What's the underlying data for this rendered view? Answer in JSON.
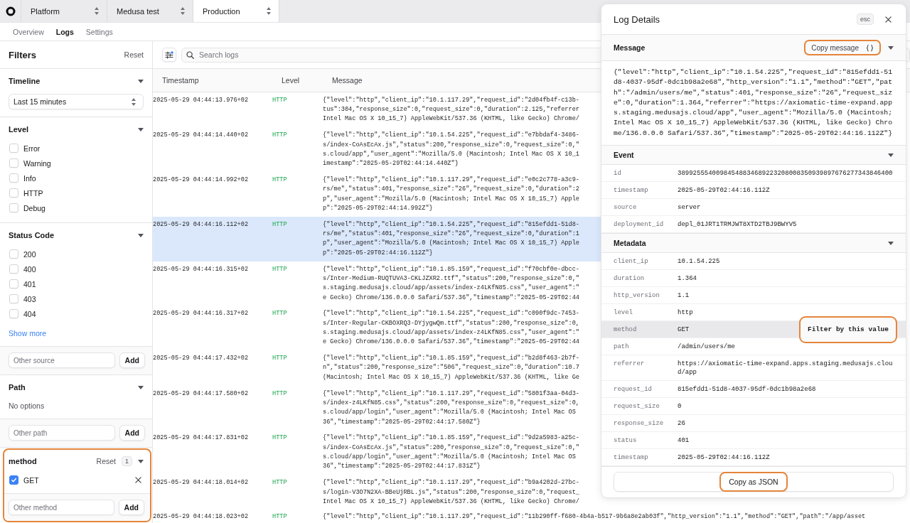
{
  "topbar": {
    "breadcrumbs": [
      {
        "label": "Platform",
        "selected": false
      },
      {
        "label": "Medusa test",
        "selected": false
      },
      {
        "label": "Production",
        "selected": true
      }
    ]
  },
  "tabs": [
    {
      "label": "Overview",
      "selected": false
    },
    {
      "label": "Logs",
      "selected": true
    },
    {
      "label": "Settings",
      "selected": false
    }
  ],
  "filters": {
    "title": "Filters",
    "reset": "Reset",
    "sections": [
      {
        "kind": "select",
        "title": "Timeline",
        "highlighted": false,
        "value": "Last 15 minutes"
      },
      {
        "kind": "checklist",
        "title": "Level",
        "highlighted": false,
        "options": [
          {
            "label": "Error",
            "checked": false
          },
          {
            "label": "Warning",
            "checked": false
          },
          {
            "label": "Info",
            "checked": false
          },
          {
            "label": "HTTP",
            "checked": false
          },
          {
            "label": "Debug",
            "checked": false
          }
        ]
      },
      {
        "kind": "checklist",
        "title": "Status Code",
        "highlighted": false,
        "options": [
          {
            "label": "200",
            "checked": false
          },
          {
            "label": "400",
            "checked": false
          },
          {
            "label": "401",
            "checked": false
          },
          {
            "label": "403",
            "checked": false
          },
          {
            "label": "404",
            "checked": false
          }
        ],
        "more": "Show more",
        "add": {
          "placeholder": "Other source",
          "button": "Add"
        }
      },
      {
        "kind": "empty",
        "title": "Path",
        "highlighted": false,
        "empty_text": "No options",
        "add": {
          "placeholder": "Other path",
          "button": "Add"
        }
      },
      {
        "kind": "checklist",
        "title": "method",
        "highlighted": true,
        "reset": "Reset",
        "count": "1",
        "options": [
          {
            "label": "GET",
            "checked": true
          }
        ],
        "add": {
          "placeholder": "Other method",
          "button": "Add"
        }
      }
    ]
  },
  "toolbar": {
    "search": {
      "placeholder": "Search logs"
    }
  },
  "table": {
    "columns": [
      "Timestamp",
      "Level",
      "Message"
    ],
    "rows": [
      {
        "timestamp": "2025-05-29 04:44:13.976+02",
        "level": "HTTP",
        "selected": false,
        "message": [
          "{\"level\":\"http\",\"client_ip\":\"10.1.117.29\",\"request_id\":\"2d04fb4f-c13b-",
          "tus\":304,\"response_size\":0,\"request_size\":0,\"duration\":2.125,\"referrer",
          "Intel Mac OS X 10_15_7) AppleWebKit/537.36 (KHTML, like Gecko) Chrome/"
        ]
      },
      {
        "timestamp": "2025-05-29 04:44:14.440+02",
        "level": "HTTP",
        "selected": false,
        "message": [
          "{\"level\":\"http\",\"client_ip\":\"10.1.54.225\",\"request_id\":\"e7bbdaf4-3486-",
          "s/index-CoAsEcAx.js\",\"status\":200,\"response_size\":0,\"request_size\":0,\"",
          "s.cloud/app\",\"user_agent\":\"Mozilla/5.0 (Macintosh; Intel Mac OS X 10_1",
          "imestamp\":\"2025-05-29T02:44:14.440Z\"}"
        ]
      },
      {
        "timestamp": "2025-05-29 04:44:14.992+02",
        "level": "HTTP",
        "selected": false,
        "message": [
          "{\"level\":\"http\",\"client_ip\":\"10.1.117.29\",\"request_id\":\"e0c2c778-a3c9-",
          "rs/me\",\"status\":401,\"response_size\":\"26\",\"request_size\":0,\"duration\":2",
          "p\",\"user_agent\":\"Mozilla/5.0 (Macintosh; Intel Mac OS X 10_15_7) Apple",
          "p\":\"2025-05-29T02:44:14.992Z\"}"
        ]
      },
      {
        "timestamp": "2025-05-29 04:44:16.112+02",
        "level": "HTTP",
        "selected": true,
        "message": [
          "{\"level\":\"http\",\"client_ip\":\"10.1.54.225\",\"request_id\":\"815efdd1-51d8-",
          "rs/me\",\"status\":401,\"response_size\":\"26\",\"request_size\":0,\"duration\":1",
          "p\",\"user_agent\":\"Mozilla/5.0 (Macintosh; Intel Mac OS X 10_15_7) Apple",
          "p\":\"2025-05-29T02:44:16.112Z\"}"
        ]
      },
      {
        "timestamp": "2025-05-29 04:44:16.315+02",
        "level": "HTTP",
        "selected": false,
        "message": [
          "{\"level\":\"http\",\"client_ip\":\"10.1.85.159\",\"request_id\":\"f70cbf0e-dbcc-",
          "s/Inter-Medium-RUQTUVA3-CKLJZXR2.ttf\",\"status\":200,\"response_size\":0,\"",
          "s.staging.medusajs.cloud/app/assets/index-z4LKfN85.css\",\"user_agent\":\"",
          "e Gecko) Chrome/136.0.0.0 Safari/537.36\",\"timestamp\":\"2025-05-29T02:44"
        ]
      },
      {
        "timestamp": "2025-05-29 04:44:16.317+02",
        "level": "HTTP",
        "selected": false,
        "message": [
          "{\"level\":\"http\",\"client_ip\":\"10.1.54.225\",\"request_id\":\"c090f9dc-7453-",
          "s/Inter-Regular-CKBOXRQ3-DYjygwQm.ttf\",\"status\":200,\"response_size\":0,",
          "s.staging.medusajs.cloud/app/assets/index-z4LKfN85.css\",\"user_agent\":\"",
          "e Gecko) Chrome/136.0.0.0 Safari/537.36\",\"timestamp\":\"2025-05-29T02:44"
        ]
      },
      {
        "timestamp": "2025-05-29 04:44:17.432+02",
        "level": "HTTP",
        "selected": false,
        "message": [
          "{\"level\":\"http\",\"client_ip\":\"10.1.85.159\",\"request_id\":\"b2d8f463-2b7f-",
          "n\",\"status\":200,\"response_size\":\"506\",\"request_size\":0,\"duration\":10.7",
          "(Macintosh; Intel Mac OS X 10_15_7) AppleWebKit/537.36 (KHTML, like Ge"
        ]
      },
      {
        "timestamp": "2025-05-29 04:44:17.580+02",
        "level": "HTTP",
        "selected": false,
        "message": [
          "{\"level\":\"http\",\"client_ip\":\"10.1.117.29\",\"request_id\":\"5801f3aa-04d3-",
          "s/index-z4LKfN85.css\",\"status\":200,\"response_size\":0,\"request_size\":0,",
          "s.cloud/app/login\",\"user_agent\":\"Mozilla/5.0 (Macintosh; Intel Mac OS",
          "36\",\"timestamp\":\"2025-05-29T02:44:17.580Z\"}"
        ]
      },
      {
        "timestamp": "2025-05-29 04:44:17.831+02",
        "level": "HTTP",
        "selected": false,
        "message": [
          "{\"level\":\"http\",\"client_ip\":\"10.1.85.159\",\"request_id\":\"9d2a5983-a25c-",
          "s/index-CoAsEcAx.js\",\"status\":200,\"response_size\":0,\"request_size\":0,\"",
          "s.cloud/app/login\",\"user_agent\":\"Mozilla/5.0 (Macintosh; Intel Mac OS",
          "36\",\"timestamp\":\"2025-05-29T02:44:17.831Z\"}"
        ]
      },
      {
        "timestamp": "2025-05-29 04:44:18.014+02",
        "level": "HTTP",
        "selected": false,
        "message": [
          "{\"level\":\"http\",\"client_ip\":\"10.1.117.29\",\"request_id\":\"b9a4202d-27bc-",
          "s/login-V3O7N2XA-BBeUjRBL.js\",\"status\":200,\"response_size\":0,\"request_",
          "Intel Mac OS X 10_15_7) AppleWebKit/537.36 (KHTML, like Gecko) Chrome/"
        ]
      },
      {
        "timestamp": "2025-05-29 04:44:18.023+02",
        "level": "HTTP",
        "selected": false,
        "message": [
          "{\"level\":\"http\",\"client_ip\":\"10.1.117.29\",\"request_id\":\"11b290ff-f680-4b4a-b517-9b6a8e2ab03f\",\"http_version\":\"1.1\",\"method\":\"GET\",\"path\":\"/app/asset"
        ]
      }
    ]
  },
  "details": {
    "title": "Log Details",
    "shortcut": "esc",
    "message_section": {
      "title": "Message",
      "copy_button": {
        "label": "Copy message",
        "highlighted": true
      },
      "text": "{\"level\":\"http\",\"client_ip\":\"10.1.54.225\",\"request_id\":\"815efdd1-51d8-4037-95df-0dc1b98a2e68\",\"http_version\":\"1.1\",\"method\":\"GET\",\"path\":\"/admin/users/me\",\"status\":401,\"response_size\":\"26\",\"request_size\":0,\"duration\":1.364,\"referrer\":\"https://axiomatic-time-expand.apps.staging.medusajs.cloud/app\",\"user_agent\":\"Mozilla/5.0 (Macintosh; Intel Mac OS X 10_15_7) AppleWebKit/537.36 (KHTML, like Gecko) Chrome/136.0.0.0 Safari/537.36\",\"timestamp\":\"2025-05-29T02:44:16.112Z\"}"
    },
    "field_sections": [
      {
        "title": "Event",
        "fields": [
          {
            "key": "id",
            "value": "38992555400984548834689223208008350939897676277343846400",
            "hovered": false
          },
          {
            "key": "timestamp",
            "value": "2025-05-29T02:44:16.112Z",
            "hovered": false
          },
          {
            "key": "source",
            "value": "server",
            "hovered": false
          },
          {
            "key": "deployment_id",
            "value": "depl_01JRT1TRMJWT8XTD2TBJ9BWYV5",
            "hovered": false
          }
        ]
      },
      {
        "title": "Metadata",
        "fields": [
          {
            "key": "client_ip",
            "value": "10.1.54.225",
            "hovered": false
          },
          {
            "key": "duration",
            "value": "1.364",
            "hovered": false
          },
          {
            "key": "http_version",
            "value": "1.1",
            "hovered": false
          },
          {
            "key": "level",
            "value": "http",
            "hovered": false
          },
          {
            "key": "method",
            "value": "GET",
            "hovered": true,
            "action": {
              "label": "Filter by this value",
              "highlighted": true
            }
          },
          {
            "key": "path",
            "value": "/admin/users/me",
            "hovered": false
          },
          {
            "key": "referrer",
            "value": "https://axiomatic-time-expand.apps.staging.medusajs.cloud/app",
            "hovered": false
          },
          {
            "key": "request_id",
            "value": "815efdd1-51d8-4037-95df-0dc1b98a2e68",
            "hovered": false
          },
          {
            "key": "request_size",
            "value": "0",
            "hovered": false
          },
          {
            "key": "response_size",
            "value": "26",
            "hovered": false
          },
          {
            "key": "status",
            "value": "401",
            "hovered": false
          },
          {
            "key": "timestamp",
            "value": "2025-05-29T02:44:16.112Z",
            "hovered": false
          }
        ]
      }
    ],
    "footer_button": {
      "label": "Copy as JSON",
      "highlighted": true
    }
  }
}
